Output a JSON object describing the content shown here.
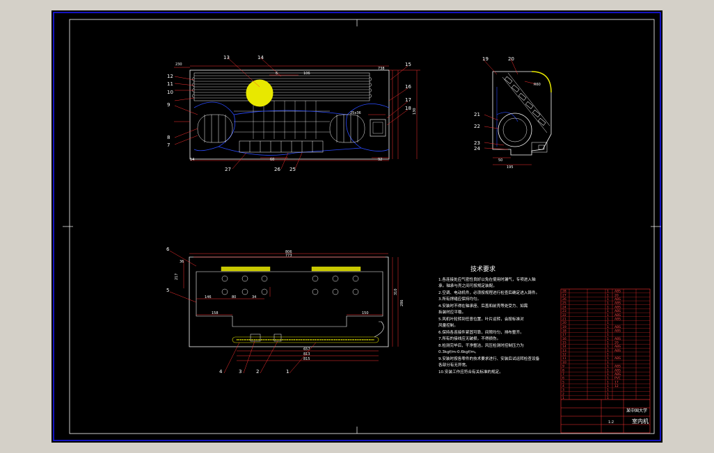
{
  "colors": {
    "background": "#d4d0c8",
    "paper": "#000000",
    "outline": "#ffffff",
    "frame_inner": "#1a1aff",
    "dimension": "#ff3030",
    "hidden": "#2b4bff",
    "highlight": "#e8e800"
  },
  "top_view": {
    "callouts": [
      "13",
      "14",
      "15",
      "16",
      "17",
      "18",
      "12",
      "11",
      "10",
      "9",
      "8",
      "7",
      "27",
      "26",
      "25"
    ],
    "dims": [
      "230",
      "6",
      "106",
      "738",
      "25x36",
      "130",
      "60",
      "92",
      "14"
    ]
  },
  "side_view": {
    "callouts": [
      "19",
      "20",
      "21",
      "22",
      "23",
      "24"
    ],
    "dims": [
      "R60",
      "50",
      "195"
    ]
  },
  "front_view": {
    "callouts": [
      "6",
      "5",
      "4",
      "3",
      "2",
      "1"
    ],
    "dims": [
      "806",
      "773",
      "36",
      "217",
      "146",
      "80",
      "34",
      "158",
      "150",
      "286",
      "310",
      "657",
      "813",
      "815"
    ]
  },
  "requirements": {
    "title": "技术要求",
    "lines": [
      "1.各连接处应气密性良好以免在使用时漏气，专项进入轴",
      "  承。轴承与壳之间可按规定装配。",
      "2.空调、电动机件，必须按规程进行检查后确定进入铸件。",
      "3.所有焊缝应保持均匀。",
      "4.安装时不得在轴承座、后盖和前壳等处受力、如需",
      "  拆装时应平稳。",
      "5.风机叶轮转到任意位置，叶片运转，会按标准对",
      "  风量控制。",
      "6.保持各连接件紧固可靠，间隙均匀，排布整齐。",
      "7.所有的接线应无破损，不得损伤。",
      "8.检测完毕后，干净整洁，风压检测时控制压力为",
      "0.3kgf/m-0.6kgf/m。",
      "9.安装时按各零件的技术要求进行、安装后试运转检查设备",
      "  各部分有无异常。",
      "10.安装工作应符合有关标准的规定。"
    ]
  },
  "title_block": {
    "company": "某中国大学",
    "drawing_name": "室内机",
    "scale": "1:2",
    "parts": [
      {
        "no": "28",
        "qty": "1",
        "material": "ABS"
      },
      {
        "no": "27",
        "qty": "1",
        "material": "20"
      },
      {
        "no": "26",
        "qty": "1",
        "material": "ABS"
      },
      {
        "no": "25",
        "qty": "1",
        "material": "ABS"
      },
      {
        "no": "24",
        "qty": "1",
        "material": "ABS"
      },
      {
        "no": "23",
        "qty": "1",
        "material": "ABS"
      },
      {
        "no": "22",
        "qty": "1",
        "material": "ABS"
      },
      {
        "no": "21",
        "qty": "1",
        "material": "ABS"
      },
      {
        "no": "20",
        "qty": "1",
        "material": ""
      },
      {
        "no": "19",
        "qty": "1",
        "material": "ABS"
      },
      {
        "no": "18",
        "qty": "1",
        "material": "ABS"
      },
      {
        "no": "17",
        "qty": "1",
        "material": ""
      },
      {
        "no": "16",
        "qty": "1",
        "material": "ABS"
      },
      {
        "no": "15",
        "qty": "1",
        "material": "20"
      },
      {
        "no": "14",
        "qty": "1",
        "material": "ABS"
      },
      {
        "no": "13",
        "qty": "1",
        "material": "ABS"
      },
      {
        "no": "12",
        "qty": "1",
        "material": ""
      },
      {
        "no": "11",
        "qty": "1",
        "material": "ABS"
      },
      {
        "no": "10",
        "qty": "1",
        "material": ""
      },
      {
        "no": "9",
        "qty": "1",
        "material": "ABS"
      },
      {
        "no": "8",
        "qty": "1",
        "material": "ABS"
      },
      {
        "no": "7",
        "qty": "1",
        "material": "ABS"
      },
      {
        "no": "6",
        "qty": "1",
        "material": "PVC"
      },
      {
        "no": "5",
        "qty": "1",
        "material": "17"
      },
      {
        "no": "4",
        "qty": "1",
        "material": "12"
      },
      {
        "no": "3",
        "qty": "1",
        "material": ""
      },
      {
        "no": "2",
        "qty": "1",
        "material": ""
      },
      {
        "no": "1",
        "qty": "1",
        "material": ""
      }
    ]
  }
}
